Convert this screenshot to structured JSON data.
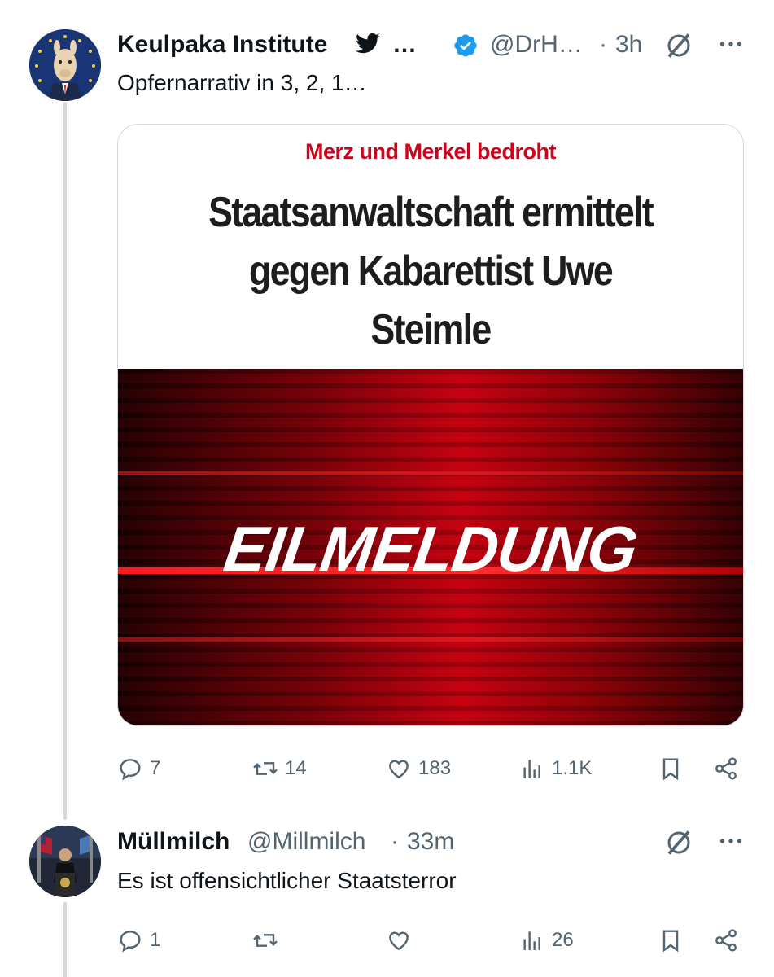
{
  "tweet": {
    "display_name": "Keulpaka Institute",
    "name_suffix": "…",
    "handle": "@DrH…",
    "separator": "·",
    "time": "3h",
    "text": "Opfernarrativ in 3, 2, 1…",
    "media": {
      "kicker": "Merz und Merkel bedroht",
      "headline": "Staatsanwaltschaft ermittelt gegen Kabarettist Uwe Steimle",
      "banner": "EILMELDUNG"
    },
    "stats": {
      "replies": "7",
      "reposts": "14",
      "likes": "183",
      "views": "1.1K"
    }
  },
  "reply": {
    "display_name": "Müllmilch",
    "handle": "@Millmilch",
    "separator": "·",
    "time": "33m",
    "text": "Es ist offensichtlicher Staatsterror",
    "stats": {
      "replies": "1",
      "reposts": "",
      "likes": "",
      "views": "26"
    }
  },
  "icons": [
    "verified-badge-icon",
    "bird-icon",
    "grok-icon",
    "more-icon",
    "reply-icon",
    "repost-icon",
    "like-icon",
    "views-icon",
    "bookmark-icon",
    "share-icon"
  ],
  "colors": {
    "verified": "#1d9bf0",
    "muted": "#536471",
    "headline_red": "#d0021b"
  }
}
